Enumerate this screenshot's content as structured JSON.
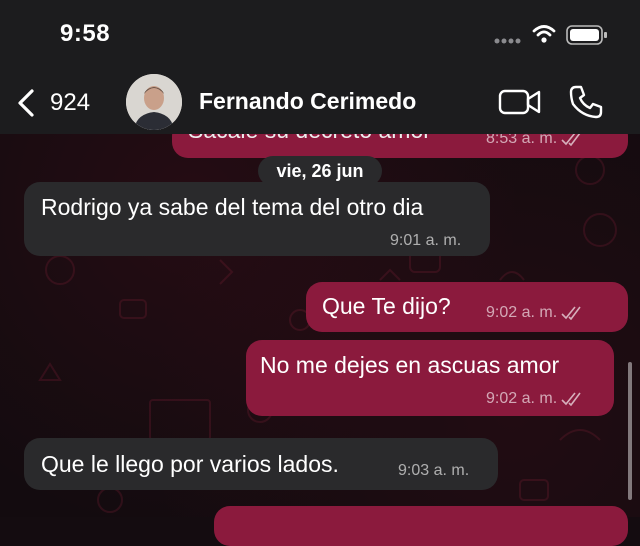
{
  "status_bar": {
    "time": "9:58"
  },
  "header": {
    "back_count": "924",
    "contact_name": "Fernando Cerimedo"
  },
  "chat": {
    "date_separator": "vie, 26 jun",
    "messages": [
      {
        "direction": "outgoing",
        "text": "Sacale su decreto amor",
        "time": "8:53 a. m.",
        "read": true
      },
      {
        "direction": "incoming",
        "text": "Rodrigo ya sabe del tema del otro dia",
        "time": "9:01 a. m."
      },
      {
        "direction": "outgoing",
        "text": "Que Te dijo?",
        "time": "9:02 a. m.",
        "read": true
      },
      {
        "direction": "outgoing",
        "text": "No me dejes en ascuas amor",
        "time": "9:02 a. m.",
        "read": true
      },
      {
        "direction": "incoming",
        "text": "Que le llego por varios lados.",
        "time": "9:03 a. m."
      }
    ]
  },
  "colors": {
    "outgoing_bubble": "#8b1a3d",
    "incoming_bubble": "#2a2a2c",
    "header_bg": "#1c1c1e"
  },
  "icons": [
    "back-chevron-icon",
    "video-call-icon",
    "phone-icon",
    "wifi-icon",
    "battery-icon",
    "read-ticks-icon"
  ]
}
